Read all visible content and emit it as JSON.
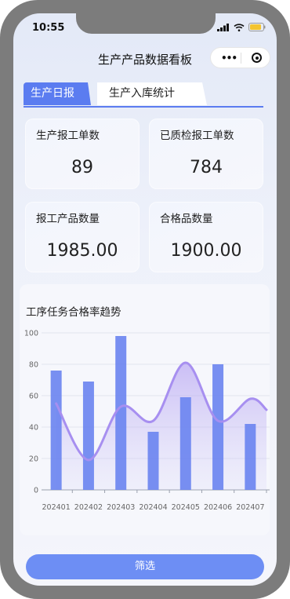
{
  "status_bar": {
    "time": "10:55"
  },
  "nav": {
    "title": "生产产品数据看板",
    "more_icon": "more-dots-icon",
    "close_icon": "target-icon"
  },
  "tabs": [
    {
      "label": "生产日报",
      "active": true
    },
    {
      "label": "生产入库统计",
      "active": false
    }
  ],
  "stats": [
    {
      "label": "生产报工单数",
      "value": "89"
    },
    {
      "label": "已质检报工单数",
      "value": "784"
    },
    {
      "label": "报工产品数量",
      "value": "1985.00"
    },
    {
      "label": "合格品数量",
      "value": "1900.00"
    }
  ],
  "chart_data": {
    "type": "bar",
    "title": "工序任务合格率趋势",
    "categories": [
      "202401",
      "202402",
      "202403",
      "202404",
      "202405",
      "202406",
      "202407"
    ],
    "series": [
      {
        "values": [
          76,
          69,
          98,
          37,
          59,
          80,
          42
        ],
        "color": "#6d86f0",
        "kind": "bar"
      },
      {
        "values": [
          55,
          19,
          53,
          44,
          81,
          44,
          58,
          51
        ],
        "color": "#a78ff0",
        "kind": "smooth-area",
        "x": [
          "202401",
          "202402",
          "202403",
          "202404",
          "202405",
          "202406",
          "202407",
          "end"
        ]
      }
    ],
    "yticks": [
      0,
      20,
      40,
      60,
      80,
      100
    ],
    "ylim": [
      0,
      100
    ],
    "grid": true,
    "accent_color": "#6d86f0",
    "line_color": "#a78ff0"
  },
  "footer": {
    "filter_label": "筛选"
  }
}
